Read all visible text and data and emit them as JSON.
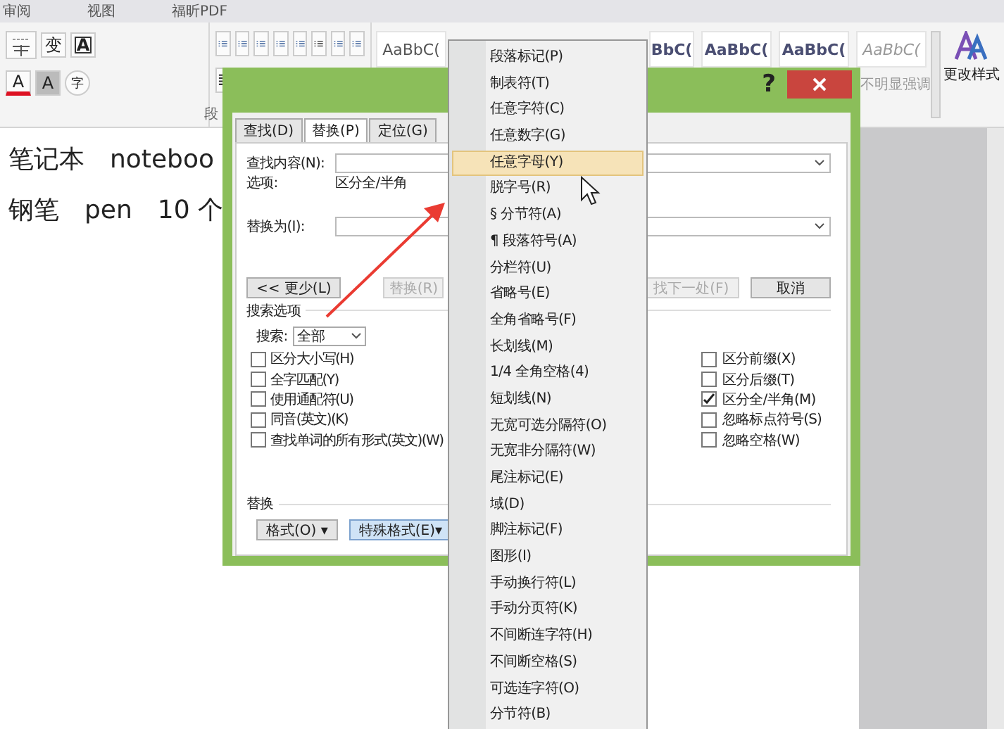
{
  "ribbon": {
    "tabs": [
      "审阅",
      "视图",
      "福昕PDF"
    ],
    "font_glyphs_top": [
      "变",
      "A"
    ],
    "font_glyphs_bottom": [
      "A",
      "A",
      "字"
    ],
    "paragraph_label": "段",
    "styles": [
      {
        "text": "AaBbC(",
        "kind": "normal"
      },
      {
        "text": "BbC(",
        "kind": "heading"
      },
      {
        "text": "AaBbC(",
        "kind": "heading"
      },
      {
        "text": "AaBbC(",
        "kind": "heading"
      },
      {
        "text": "AaBbC(",
        "kind": "subtle"
      }
    ],
    "style_caption": "不明显强调",
    "change_styles": "更改样式"
  },
  "document": {
    "lines": [
      [
        "笔记本",
        "noteboo"
      ],
      [
        "钢笔",
        "pen",
        "10 个"
      ]
    ]
  },
  "dialog": {
    "help": "?",
    "tabs": [
      {
        "label": "查找(D)",
        "selected": false
      },
      {
        "label": "替换(P)",
        "selected": true
      },
      {
        "label": "定位(G)",
        "selected": false
      }
    ],
    "find_label": "查找内容(N):",
    "options_label": "选项:",
    "options_value": "区分全/半角",
    "replace_label": "替换为(I):",
    "buttons": [
      {
        "label": "<< 更少(L)",
        "disabled": false
      },
      {
        "label": "替换(R)",
        "disabled": true
      },
      {
        "label": "找下一处(F)",
        "disabled": true
      },
      {
        "label": "取消",
        "disabled": false
      }
    ],
    "search_options_title": "搜索选项",
    "search_label": "搜索:",
    "search_value": "全部",
    "left_options": [
      {
        "label": "区分大小写(H)",
        "checked": false
      },
      {
        "label": "全字匹配(Y)",
        "checked": false
      },
      {
        "label": "使用通配符(U)",
        "checked": false
      },
      {
        "label": "同音(英文)(K)",
        "checked": false
      },
      {
        "label": "查找单词的所有形式(英文)(W)",
        "checked": false
      }
    ],
    "right_options": [
      {
        "label": "区分前缀(X)",
        "checked": false
      },
      {
        "label": "区分后缀(T)",
        "checked": false
      },
      {
        "label": "区分全/半角(M)",
        "checked": true
      },
      {
        "label": "忽略标点符号(S)",
        "checked": false
      },
      {
        "label": "忽略空格(W)",
        "checked": false
      }
    ],
    "replace_title": "替换",
    "bottom_buttons": [
      {
        "label": "格式(O) ▾",
        "pressed": false
      },
      {
        "label": "特殊格式(E)▾",
        "pressed": true
      }
    ]
  },
  "menu": {
    "items": [
      {
        "label": "段落标记(P)",
        "selected": false
      },
      {
        "label": "制表符(T)",
        "selected": false
      },
      {
        "label": "任意字符(C)",
        "selected": false
      },
      {
        "label": "任意数字(G)",
        "selected": false
      },
      {
        "label": "任意字母(Y)",
        "selected": true
      },
      {
        "label": "脱字号(R)",
        "selected": false
      },
      {
        "label": "§ 分节符(A)",
        "selected": false
      },
      {
        "label": "¶ 段落符号(A)",
        "selected": false
      },
      {
        "label": "分栏符(U)",
        "selected": false
      },
      {
        "label": "省略号(E)",
        "selected": false
      },
      {
        "label": "全角省略号(F)",
        "selected": false
      },
      {
        "label": "长划线(M)",
        "selected": false
      },
      {
        "label": "1/4 全角空格(4)",
        "selected": false
      },
      {
        "label": "短划线(N)",
        "selected": false
      },
      {
        "label": "无宽可选分隔符(O)",
        "selected": false
      },
      {
        "label": "无宽非分隔符(W)",
        "selected": false
      },
      {
        "label": "尾注标记(E)",
        "selected": false
      },
      {
        "label": "域(D)",
        "selected": false
      },
      {
        "label": "脚注标记(F)",
        "selected": false
      },
      {
        "label": "图形(I)",
        "selected": false
      },
      {
        "label": "手动换行符(L)",
        "selected": false
      },
      {
        "label": "手动分页符(K)",
        "selected": false
      },
      {
        "label": "不间断连字符(H)",
        "selected": false
      },
      {
        "label": "不间断空格(S)",
        "selected": false
      },
      {
        "label": "可选连字符(O)",
        "selected": false
      },
      {
        "label": "分节符(B)",
        "selected": false
      }
    ]
  }
}
